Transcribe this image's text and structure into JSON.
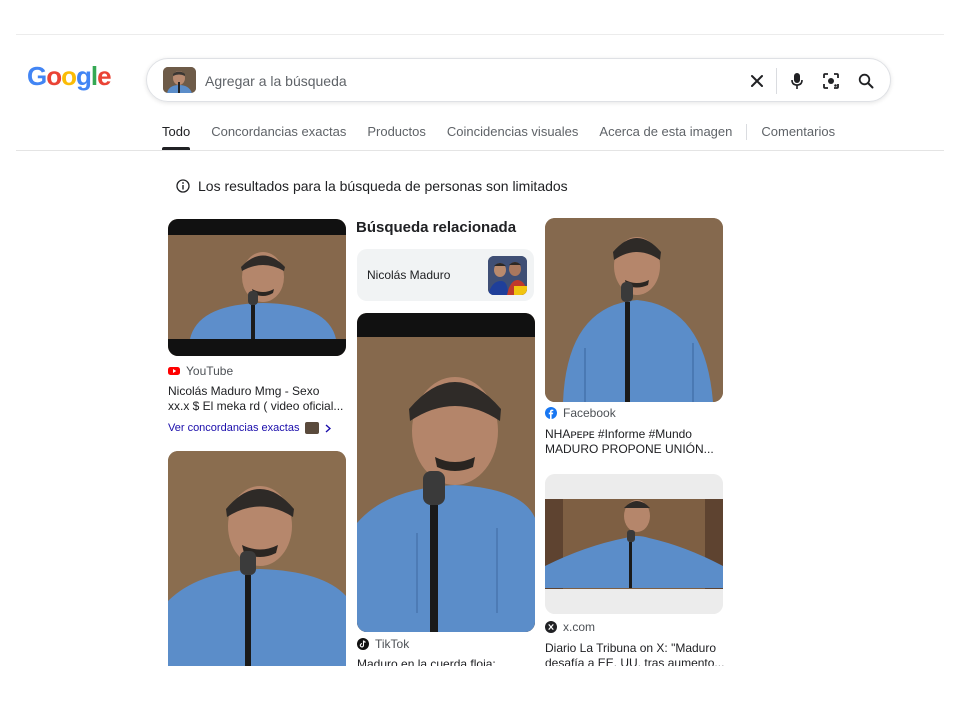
{
  "header": {
    "logo_text": "Google",
    "search": {
      "placeholder": "Agregar a la búsqueda",
      "value": ""
    }
  },
  "tabs": [
    {
      "label": "Todo",
      "active": true
    },
    {
      "label": "Concordancias exactas",
      "active": false
    },
    {
      "label": "Productos",
      "active": false
    },
    {
      "label": "Coincidencias visuales",
      "active": false
    },
    {
      "label": "Acerca de esta imagen",
      "active": false
    },
    {
      "label": "Comentarios",
      "active": false
    }
  ],
  "notice": {
    "text": "Los resultados para la búsqueda de personas son limitados"
  },
  "related": {
    "heading": "Búsqueda relacionada",
    "chip_label": "Nicolás Maduro"
  },
  "results": [
    {
      "source": "YouTube",
      "title_line1": "Nicolás Maduro Mmg - Sexo",
      "title_line2": "xx.x $ El meka rd ( video oficial...",
      "link": "Ver concordancias exactas"
    },
    {
      "source": "Facebook",
      "title_line1": "NHAᴘᴇᴘᴇ #Informe #Mundo",
      "title_line2": "MADURO PROPONE UNIÓN..."
    },
    {
      "source": "TikTok",
      "title_line1": "Maduro en la cuerda floja:"
    },
    {
      "source": "x.com",
      "title_line1": "Diario La Tribuna on X: \"Maduro",
      "title_line2": "desafía a EE. UU. tras aumento..."
    }
  ],
  "colors": {
    "youtube": "#ff0000",
    "facebook": "#1877f2",
    "link": "#1a0dab",
    "shirt_blue": "#5b8dc9",
    "wall_brown": "#8a6d4f"
  }
}
